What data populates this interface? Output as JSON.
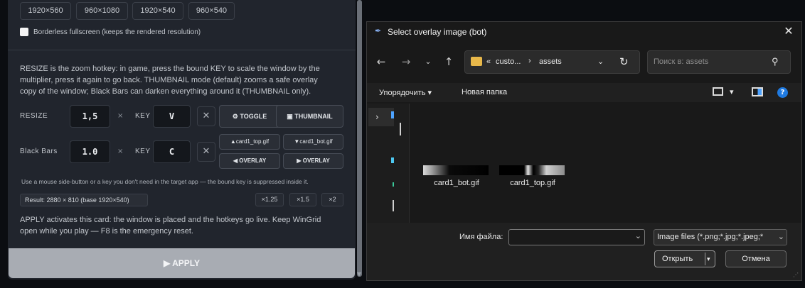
{
  "app": {
    "resolutions": [
      "1920×560",
      "960×1080",
      "1920×540",
      "960×540"
    ],
    "borderless_label": "Borderless fullscreen (keeps the rendered resolution)",
    "description": [
      "RESIZE is the zoom hotkey: in game, press the bound KEY to scale the window by the",
      "multiplier, press it again to go back. THUMBNAIL mode (default) zooms a safe overlay",
      "copy of the window; Black Bars can darken everything around it (THUMBNAIL only)."
    ],
    "resize": {
      "label": "RESIZE",
      "value": "1,5",
      "times": "×",
      "key_label": "KEY",
      "key": "V",
      "clear": "✕",
      "toggle": "⚙ TOGGLE",
      "thumbnail": "▣ THUMBNAIL"
    },
    "black_bars": {
      "label": "Black Bars",
      "value": "1.0",
      "times": "×",
      "key_label": "KEY",
      "key": "C",
      "clear": "✕",
      "card_top": "▲card1_top.gif",
      "card_bot": "▼card1_bot.gif",
      "overlay_left": "◀ OVERLAY",
      "overlay_right": "▶ OVERLAY"
    },
    "note": "Use a mouse side-button or a key you don't need in the target app — the bound key is suppressed inside it.",
    "result": "Result: 2880 × 810 (base 1920×540)",
    "multipliers": [
      "×1.25",
      "×1.5",
      "×2"
    ],
    "apply_text": [
      "APPLY activates this card: the window is placed and the hotkeys go live. Keep WinGrid",
      "open while you play — F8 is the emergency reset."
    ],
    "apply_button": "▶ APPLY"
  },
  "dialog": {
    "title": "Select overlay image (bot)",
    "breadcrumb": {
      "prefix": "«",
      "part1": "custo...",
      "separator": "›",
      "part2": "assets"
    },
    "search_placeholder": "Поиск в: assets",
    "sort_label": "Упорядочить",
    "new_folder": "Новая папка",
    "files": [
      "card1_bot.gif",
      "card1_top.gif"
    ],
    "filename_label": "Имя файла:",
    "filename_value": "",
    "filter": "Image files (*.png;*.jpg;*.jpeg;*",
    "open_button": "Открыть",
    "cancel_button": "Отмена"
  }
}
